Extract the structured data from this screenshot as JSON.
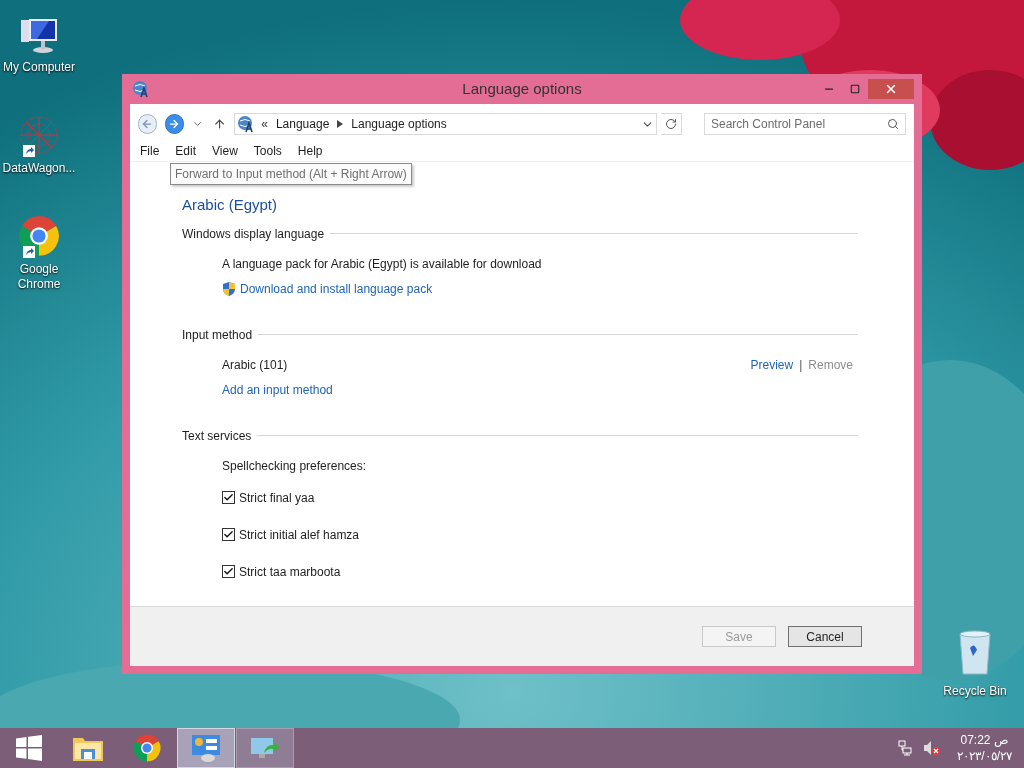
{
  "desktop_icons": [
    {
      "kind": "computer",
      "label": "My Computer",
      "shortcut": false
    },
    {
      "kind": "network",
      "label": "DataWagon...",
      "shortcut": true
    },
    {
      "kind": "chrome",
      "label": "Google Chrome",
      "shortcut": true
    }
  ],
  "recycle_bin": {
    "label": "Recycle Bin"
  },
  "window": {
    "title": "Language options",
    "nav": {
      "back_enabled": false,
      "prefix": "«",
      "breadcrumb": [
        "Language",
        "Language options"
      ],
      "search_placeholder": "Search Control Panel"
    },
    "menu": [
      "File",
      "Edit",
      "View",
      "Tools",
      "Help"
    ],
    "tooltip": "Forward to Input method (Alt + Right Arrow)",
    "heading": "Arabic (Egypt)",
    "sections": [
      {
        "title": "Windows display language",
        "items": [
          {
            "kind": "text",
            "text": "A language pack for Arabic (Egypt) is available for download"
          },
          {
            "kind": "link",
            "text": "Download and install language pack",
            "shield": true
          }
        ]
      },
      {
        "title": "Input method",
        "items": [
          {
            "kind": "method",
            "text": "Arabic (101)",
            "actions": [
              {
                "label": "Preview",
                "disabled": false
              },
              {
                "label": "Remove",
                "disabled": true
              }
            ],
            "separator": "|"
          },
          {
            "kind": "link",
            "text": "Add an input method",
            "shield": false
          }
        ]
      },
      {
        "title": "Text services",
        "items": [
          {
            "kind": "text",
            "text": "Spellchecking preferences:"
          },
          {
            "kind": "checkbox",
            "text": "Strict final yaa",
            "checked": true
          },
          {
            "kind": "checkbox",
            "text": "Strict initial alef hamza",
            "checked": true
          },
          {
            "kind": "checkbox",
            "text": "Strict taa marboota",
            "checked": true
          }
        ]
      }
    ],
    "buttons": [
      {
        "label": "Save",
        "disabled": true
      },
      {
        "label": "Cancel",
        "disabled": false
      }
    ]
  },
  "taskbar": {
    "items": [
      {
        "kind": "start",
        "open": false,
        "selected": false
      },
      {
        "kind": "explorer",
        "open": false,
        "selected": false
      },
      {
        "kind": "chrome",
        "open": false,
        "selected": false
      },
      {
        "kind": "control-panel",
        "open": true,
        "selected": true
      },
      {
        "kind": "sync",
        "open": true,
        "selected": false
      }
    ],
    "clock": {
      "time": "ص 07:22",
      "date": "٢٠٢٣/٠٥/٢٧"
    }
  }
}
